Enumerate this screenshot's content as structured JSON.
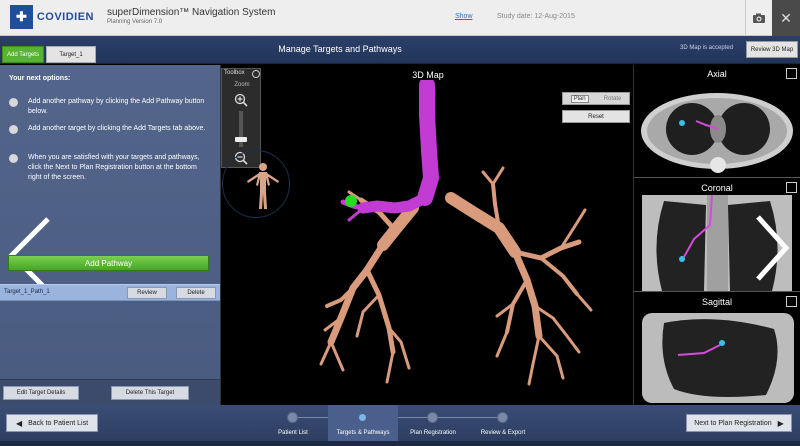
{
  "titlebar": {
    "logo_mark": "✚",
    "logo_text": "COVIDIEN",
    "app_title": "superDimension™ Navigation System",
    "app_version": "Planning Version 7.0",
    "show_link": "Show",
    "study_date": "Study date: 12-Aug-2015",
    "icons": {
      "camera": "camera-icon",
      "close": "close-icon"
    }
  },
  "tabbar": {
    "tabs": [
      {
        "label": "Add Targets",
        "color": "#58b234"
      },
      {
        "label": "Target_1"
      }
    ],
    "screen_title": "Manage Targets and Pathways",
    "map_status": "3D Map is accepted",
    "review_button": "Review 3D Map"
  },
  "left_panel": {
    "heading": "Your next options:",
    "options": [
      "Add another pathway by clicking the Add Pathway button below.",
      "Add another target by clicking the Add Targets tab above.",
      "When you are satisfied with your targets and pathways, click the Next to Plan Registration button at the bottom right of the screen."
    ],
    "add_pathway": "Add Pathway",
    "pathway": {
      "name": "Target_1_Path_1",
      "review": "Review",
      "delete": "Delete"
    },
    "footer": {
      "edit_target": "Edit Target Details",
      "delete_target": "Delete This Target"
    }
  },
  "map": {
    "title": "3D Map",
    "toolbox_label": "Toolbox",
    "zoom_label": "Zoom",
    "zoom_level": 0.15,
    "plan_label": "Plan",
    "rotate_label": "Rotate",
    "reset_label": "Reset",
    "colors": {
      "pathway": "#c23bd2",
      "airway": "#d99b7c",
      "target": "#22dd22"
    }
  },
  "ct": {
    "views": [
      "Axial",
      "Coronal",
      "Sagittal"
    ]
  },
  "bottombar": {
    "back": "Back to Patient List",
    "next": "Next to Plan Registration",
    "steps": [
      "Patient List",
      "Targets & Pathways",
      "Plan Registration",
      "Review & Export"
    ],
    "active_step": 1
  }
}
